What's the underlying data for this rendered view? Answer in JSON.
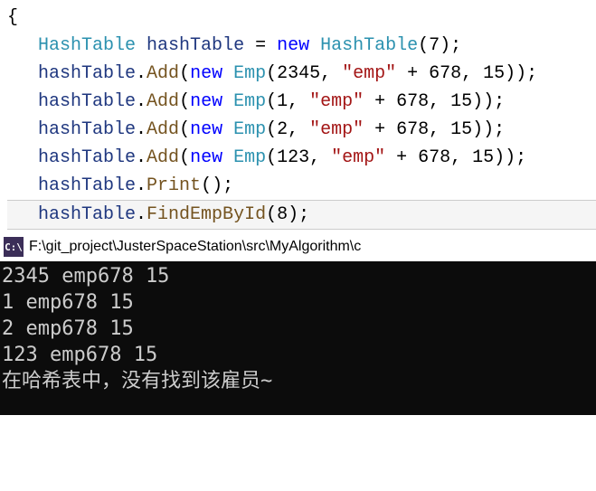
{
  "code": {
    "brace": "{",
    "lines": [
      {
        "tokens": [
          {
            "cls": "type",
            "t": "HashTable"
          },
          {
            "cls": "punct",
            "t": " "
          },
          {
            "cls": "local-var",
            "t": "hashTable"
          },
          {
            "cls": "punct",
            "t": " = "
          },
          {
            "cls": "keyword",
            "t": "new"
          },
          {
            "cls": "punct",
            "t": " "
          },
          {
            "cls": "type",
            "t": "HashTable"
          },
          {
            "cls": "punct",
            "t": "(7);"
          }
        ]
      },
      {
        "tokens": [
          {
            "cls": "local-var",
            "t": "hashTable"
          },
          {
            "cls": "punct",
            "t": "."
          },
          {
            "cls": "method",
            "t": "Add"
          },
          {
            "cls": "punct",
            "t": "("
          },
          {
            "cls": "keyword",
            "t": "new"
          },
          {
            "cls": "punct",
            "t": " "
          },
          {
            "cls": "type",
            "t": "Emp"
          },
          {
            "cls": "punct",
            "t": "(2345, "
          },
          {
            "cls": "string",
            "t": "\"emp\""
          },
          {
            "cls": "punct",
            "t": " + 678, 15));"
          }
        ]
      },
      {
        "tokens": [
          {
            "cls": "local-var",
            "t": "hashTable"
          },
          {
            "cls": "punct",
            "t": "."
          },
          {
            "cls": "method",
            "t": "Add"
          },
          {
            "cls": "punct",
            "t": "("
          },
          {
            "cls": "keyword",
            "t": "new"
          },
          {
            "cls": "punct",
            "t": " "
          },
          {
            "cls": "type",
            "t": "Emp"
          },
          {
            "cls": "punct",
            "t": "(1, "
          },
          {
            "cls": "string",
            "t": "\"emp\""
          },
          {
            "cls": "punct",
            "t": " + 678, 15));"
          }
        ]
      },
      {
        "tokens": [
          {
            "cls": "local-var",
            "t": "hashTable"
          },
          {
            "cls": "punct",
            "t": "."
          },
          {
            "cls": "method",
            "t": "Add"
          },
          {
            "cls": "punct",
            "t": "("
          },
          {
            "cls": "keyword",
            "t": "new"
          },
          {
            "cls": "punct",
            "t": " "
          },
          {
            "cls": "type",
            "t": "Emp"
          },
          {
            "cls": "punct",
            "t": "(2, "
          },
          {
            "cls": "string",
            "t": "\"emp\""
          },
          {
            "cls": "punct",
            "t": " + 678, 15));"
          }
        ]
      },
      {
        "tokens": [
          {
            "cls": "local-var",
            "t": "hashTable"
          },
          {
            "cls": "punct",
            "t": "."
          },
          {
            "cls": "method",
            "t": "Add"
          },
          {
            "cls": "punct",
            "t": "("
          },
          {
            "cls": "keyword",
            "t": "new"
          },
          {
            "cls": "punct",
            "t": " "
          },
          {
            "cls": "type",
            "t": "Emp"
          },
          {
            "cls": "punct",
            "t": "(123, "
          },
          {
            "cls": "string",
            "t": "\"emp\""
          },
          {
            "cls": "punct",
            "t": " + 678, 15));"
          }
        ]
      },
      {
        "tokens": [
          {
            "cls": "local-var",
            "t": "hashTable"
          },
          {
            "cls": "punct",
            "t": "."
          },
          {
            "cls": "method",
            "t": "Print"
          },
          {
            "cls": "punct",
            "t": "();"
          }
        ]
      },
      {
        "highlighted": true,
        "tokens": [
          {
            "cls": "local-var",
            "t": "hashTable"
          },
          {
            "cls": "punct",
            "t": "."
          },
          {
            "cls": "method",
            "t": "FindEmpById"
          },
          {
            "cls": "punct",
            "t": "(8);"
          }
        ]
      }
    ]
  },
  "console": {
    "icon_text": "C:\\",
    "title": "F:\\git_project\\JusterSpaceStation\\src\\MyAlgorithm\\c",
    "output": [
      "2345 emp678 15",
      "1 emp678 15",
      "2 emp678 15",
      "123 emp678 15",
      "在哈希表中，没有找到该雇员~"
    ]
  }
}
